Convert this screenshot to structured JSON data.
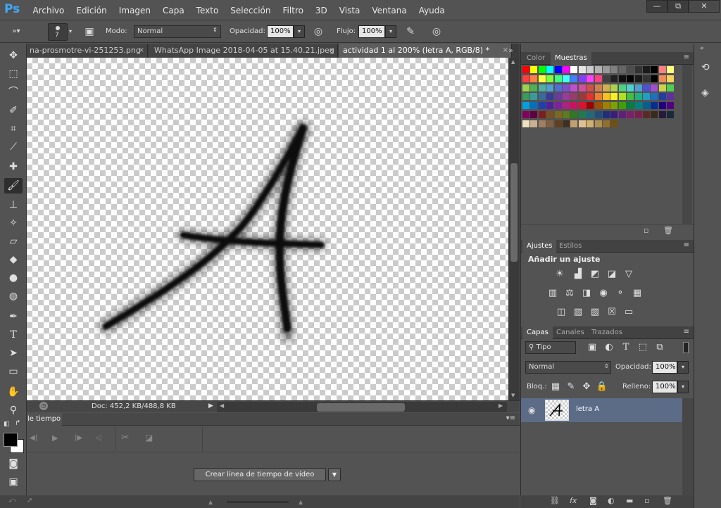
{
  "app": {
    "logo": "Ps"
  },
  "menu": [
    "Archivo",
    "Edición",
    "Imagen",
    "Capa",
    "Texto",
    "Selección",
    "Filtro",
    "3D",
    "Vista",
    "Ventana",
    "Ayuda"
  ],
  "window_controls": [
    "—",
    "⧉",
    "✕"
  ],
  "options": {
    "brush_size": "7",
    "mode_label": "Modo:",
    "mode_value": "Normal",
    "opacity_label": "Opacidad:",
    "opacity_value": "100%",
    "flow_label": "Flujo:",
    "flow_value": "100%"
  },
  "tabs": [
    {
      "label": "na-prosmotre-vi-251253.png",
      "close": "×"
    },
    {
      "label": "WhatsApp Image 2018-04-05 at 15.40.21.jpeg",
      "close": "×"
    },
    {
      "label": "actividad 1 al 200% (letra A, RGB/8) *",
      "close": "×"
    }
  ],
  "status": {
    "doc": "Doc: 452,2 KB/488,8 KB"
  },
  "timeline": {
    "title": "le tiempo",
    "create_button": "Crear línea de tiempo de vídeo"
  },
  "panels": {
    "color_tabs": [
      "Color",
      "Muestras"
    ],
    "adjust_tabs": [
      "Ajustes",
      "Estilos"
    ],
    "adjust_title": "Añadir un ajuste",
    "layer_tabs": [
      "Capas",
      "Canales",
      "Trazados"
    ]
  },
  "layers": {
    "filter_value": "Tipo",
    "blend_value": "Normal",
    "opacity_label": "Opacidad:",
    "opacity_value": "100%",
    "lock_label": "Bloq.:",
    "fill_label": "Relleno:",
    "fill_value": "100%",
    "items": [
      {
        "name": "letra A"
      }
    ]
  },
  "swatch_rows": [
    [
      "#ff0000",
      "#ffff00",
      "#00ff00",
      "#00ffff",
      "#0000ff",
      "#ff00ff",
      "#ffffff",
      "#e6e6e6",
      "#cccccc",
      "#b3b3b3",
      "#999999",
      "#808080",
      "#666666",
      "#4d4d4d",
      "#333333",
      "#1a1a1a",
      "#000000",
      "#ff8080",
      "#ffff80"
    ],
    [
      "#ff4040",
      "#ff8040",
      "#ffff40",
      "#80ff40",
      "#40ff80",
      "#40ffff",
      "#4080ff",
      "#8040ff",
      "#ff40ff",
      "#ff4080",
      "#404040",
      "#202020",
      "#101010",
      "#000000",
      "#1a1a1a",
      "#333333",
      "#000000",
      "#f08c5a",
      "#f5d25a"
    ],
    [
      "#9fd04f",
      "#4fb04f",
      "#4fb0a0",
      "#4fa0d0",
      "#4f70d0",
      "#7f4fd0",
      "#c04fd0",
      "#d04f9f",
      "#d04f4f",
      "#d07f4f",
      "#d0b04f",
      "#b0d04f",
      "#4fd07f",
      "#4fd0d0",
      "#4f9fd0",
      "#4f4fd0",
      "#9f4fd0",
      "#d0d04f",
      "#4fd04f"
    ],
    [
      "#3a9b5a",
      "#3a9b9b",
      "#3a6b9b",
      "#3a3a9b",
      "#6b3a9b",
      "#9b3a9b",
      "#9b3a6b",
      "#9b3a3a",
      "#e8302e",
      "#f07c28",
      "#f8c020",
      "#f8f020",
      "#b0e020",
      "#40c040",
      "#20b080",
      "#20a0c0",
      "#2070c0",
      "#2040a0",
      "#6030a0"
    ],
    [
      "#00a0e0",
      "#0070c0",
      "#2040b0",
      "#5020a0",
      "#8020a0",
      "#b02080",
      "#d01060",
      "#e01030",
      "#a00000",
      "#a05000",
      "#a08000",
      "#80a000",
      "#40a000",
      "#008040",
      "#008080",
      "#006090",
      "#003090",
      "#200080",
      "#500080"
    ],
    [
      "#800060",
      "#600040",
      "#7a1f1f",
      "#7a4f1f",
      "#7a6a1f",
      "#5f7a1f",
      "#2f7a1f",
      "#1f7a4f",
      "#1f6a7a",
      "#1f4f7a",
      "#1f2f7a",
      "#3a1f7a",
      "#5f1f7a",
      "#7a1f6a",
      "#7a1f4f",
      "#5a2a2a",
      "#3a2a1a",
      "#2a1a3a",
      "#1a2a3a"
    ],
    [
      "#f0e0c0",
      "#c8b090",
      "#a08060",
      "#806040",
      "#604020",
      "#403020",
      "#c0a070",
      "#e0c090",
      "#d0b070",
      "#b09050",
      "#907030",
      "#705010"
    ]
  ]
}
